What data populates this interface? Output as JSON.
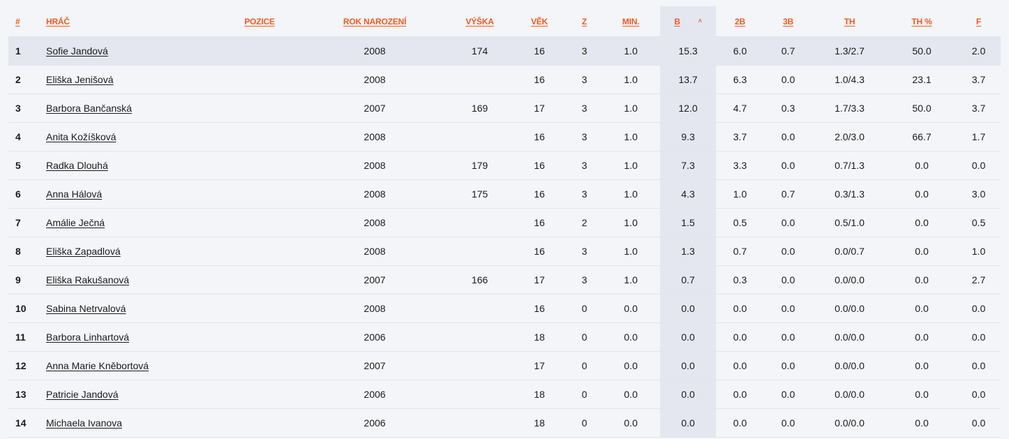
{
  "columns": [
    "#",
    "HRÁČ",
    "POZICE",
    "ROK NAROZENÍ",
    "VÝŠKA",
    "VĚK",
    "Z",
    "MIN.",
    "B",
    "2B",
    "3B",
    "TH",
    "TH %",
    "F"
  ],
  "sort_indicator": "˄",
  "rows": [
    [
      "1",
      "Sofie Jandová",
      "",
      "2008",
      "174",
      "16",
      "3",
      "1.0",
      "15.3",
      "6.0",
      "0.7",
      "1.3/2.7",
      "50.0",
      "2.0"
    ],
    [
      "2",
      "Eliška Jenišová",
      "",
      "2008",
      "",
      "16",
      "3",
      "1.0",
      "13.7",
      "6.3",
      "0.0",
      "1.0/4.3",
      "23.1",
      "3.7"
    ],
    [
      "3",
      "Barbora Bančanská",
      "",
      "2007",
      "169",
      "17",
      "3",
      "1.0",
      "12.0",
      "4.7",
      "0.3",
      "1.7/3.3",
      "50.0",
      "3.7"
    ],
    [
      "4",
      "Anita Kožíšková",
      "",
      "2008",
      "",
      "16",
      "3",
      "1.0",
      "9.3",
      "3.7",
      "0.0",
      "2.0/3.0",
      "66.7",
      "1.7"
    ],
    [
      "5",
      "Radka Dlouhá",
      "",
      "2008",
      "179",
      "16",
      "3",
      "1.0",
      "7.3",
      "3.3",
      "0.0",
      "0.7/1.3",
      "0.0",
      "0.0"
    ],
    [
      "6",
      "Anna Hálová",
      "",
      "2008",
      "175",
      "16",
      "3",
      "1.0",
      "4.3",
      "1.0",
      "0.7",
      "0.3/1.3",
      "0.0",
      "3.0"
    ],
    [
      "7",
      "Amálie Ječná",
      "",
      "2008",
      "",
      "16",
      "2",
      "1.0",
      "1.5",
      "0.5",
      "0.0",
      "0.5/1.0",
      "0.0",
      "0.5"
    ],
    [
      "8",
      "Eliška Zapadlová",
      "",
      "2008",
      "",
      "16",
      "3",
      "1.0",
      "1.3",
      "0.7",
      "0.0",
      "0.0/0.7",
      "0.0",
      "1.0"
    ],
    [
      "9",
      "Eliška Rakušanová",
      "",
      "2007",
      "166",
      "17",
      "3",
      "1.0",
      "0.7",
      "0.3",
      "0.0",
      "0.0/0.0",
      "0.0",
      "2.7"
    ],
    [
      "10",
      "Sabina Netrvalová",
      "",
      "2008",
      "",
      "16",
      "0",
      "0.0",
      "0.0",
      "0.0",
      "0.0",
      "0.0/0.0",
      "0.0",
      "0.0"
    ],
    [
      "11",
      "Barbora Linhartová",
      "",
      "2006",
      "",
      "18",
      "0",
      "0.0",
      "0.0",
      "0.0",
      "0.0",
      "0.0/0.0",
      "0.0",
      "0.0"
    ],
    [
      "12",
      "Anna Marie Kněbortová",
      "",
      "2007",
      "",
      "17",
      "0",
      "0.0",
      "0.0",
      "0.0",
      "0.0",
      "0.0/0.0",
      "0.0",
      "0.0"
    ],
    [
      "13",
      "Patricie Jandová",
      "",
      "2006",
      "",
      "18",
      "0",
      "0.0",
      "0.0",
      "0.0",
      "0.0",
      "0.0/0.0",
      "0.0",
      "0.0"
    ],
    [
      "14",
      "Michaela Ivanova",
      "",
      "2006",
      "",
      "18",
      "0",
      "0.0",
      "0.0",
      "0.0",
      "0.0",
      "0.0/0.0",
      "0.0",
      "0.0"
    ]
  ]
}
